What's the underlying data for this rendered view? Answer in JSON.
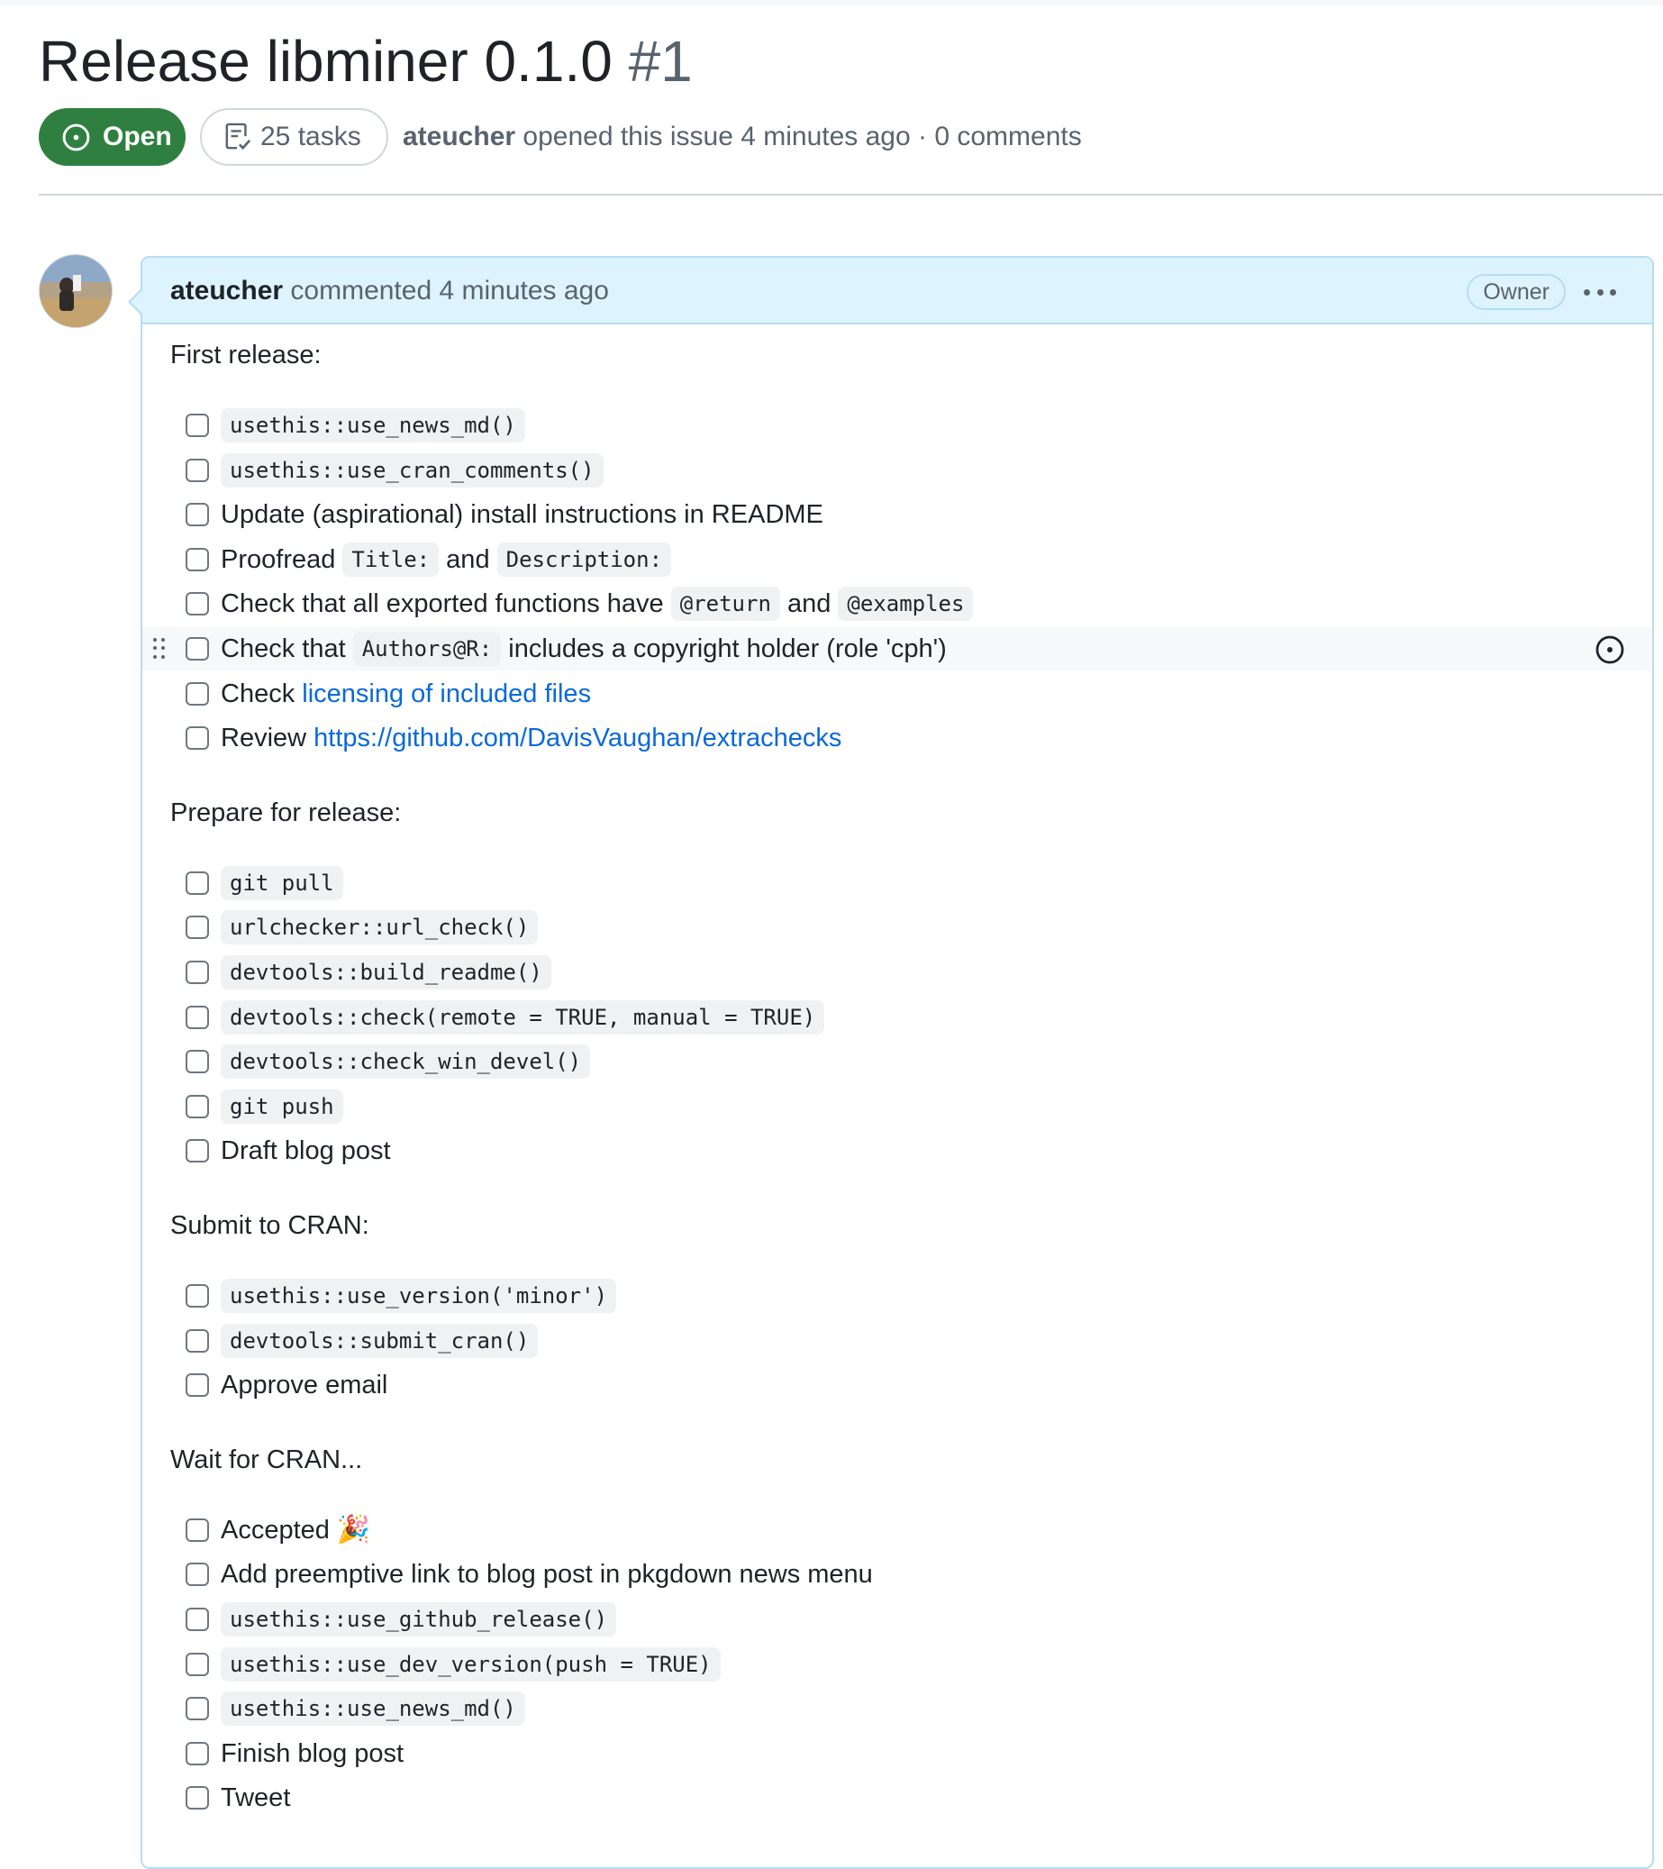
{
  "issue": {
    "title": "Release libminer 0.1.0",
    "number": "#1",
    "state": "Open",
    "tasks_label": "25 tasks",
    "author": "ateucher",
    "meta_text": " opened this issue 4 minutes ago · 0 comments"
  },
  "comment": {
    "author": "ateucher",
    "meta_text": " commented 4 minutes ago",
    "badge": "Owner"
  },
  "icons": {
    "state": "issue-opened-icon",
    "tasks": "checklist-icon",
    "kebab": "kebab-horizontal-icon",
    "drag": "grabber-icon",
    "convert": "issue-opened-icon"
  },
  "colors": {
    "open_green": "#2f8040",
    "link_blue": "#0969da",
    "header_bg": "#ddf4ff",
    "header_border": "#b6dcf5"
  },
  "sections": [
    {
      "heading": "First release:",
      "tasks": [
        [
          {
            "t": "code",
            "v": "usethis::use_news_md()"
          }
        ],
        [
          {
            "t": "code",
            "v": "usethis::use_cran_comments()"
          }
        ],
        [
          {
            "t": "text",
            "v": "Update (aspirational) install instructions in README"
          }
        ],
        [
          {
            "t": "text",
            "v": "Proofread "
          },
          {
            "t": "code",
            "v": "Title:"
          },
          {
            "t": "text",
            "v": " and "
          },
          {
            "t": "code",
            "v": "Description:"
          }
        ],
        [
          {
            "t": "text",
            "v": "Check that all exported functions have "
          },
          {
            "t": "code",
            "v": "@return"
          },
          {
            "t": "text",
            "v": " and "
          },
          {
            "t": "code",
            "v": "@examples"
          }
        ],
        [
          {
            "t": "text",
            "v": "Check that "
          },
          {
            "t": "code",
            "v": "Authors@R:"
          },
          {
            "t": "text",
            "v": " includes a copyright holder (role 'cph')"
          }
        ],
        [
          {
            "t": "text",
            "v": "Check "
          },
          {
            "t": "link",
            "v": "licensing of included files"
          }
        ],
        [
          {
            "t": "text",
            "v": "Review "
          },
          {
            "t": "link",
            "v": "https://github.com/DavisVaughan/extrachecks"
          }
        ]
      ]
    },
    {
      "heading": "Prepare for release:",
      "tasks": [
        [
          {
            "t": "code",
            "v": "git pull"
          }
        ],
        [
          {
            "t": "code",
            "v": "urlchecker::url_check()"
          }
        ],
        [
          {
            "t": "code",
            "v": "devtools::build_readme()"
          }
        ],
        [
          {
            "t": "code",
            "v": "devtools::check(remote = TRUE, manual = TRUE)"
          }
        ],
        [
          {
            "t": "code",
            "v": "devtools::check_win_devel()"
          }
        ],
        [
          {
            "t": "code",
            "v": "git push"
          }
        ],
        [
          {
            "t": "text",
            "v": "Draft blog post"
          }
        ]
      ]
    },
    {
      "heading": "Submit to CRAN:",
      "tasks": [
        [
          {
            "t": "code",
            "v": "usethis::use_version('minor')"
          }
        ],
        [
          {
            "t": "code",
            "v": "devtools::submit_cran()"
          }
        ],
        [
          {
            "t": "text",
            "v": "Approve email"
          }
        ]
      ]
    },
    {
      "heading": "Wait for CRAN...",
      "tasks": [
        [
          {
            "t": "text",
            "v": "Accepted"
          },
          {
            "t": "emoji",
            "v": "🎉"
          }
        ],
        [
          {
            "t": "text",
            "v": "Add preemptive link to blog post in pkgdown news menu"
          }
        ],
        [
          {
            "t": "code",
            "v": "usethis::use_github_release()"
          }
        ],
        [
          {
            "t": "code",
            "v": "usethis::use_dev_version(push = TRUE)"
          }
        ],
        [
          {
            "t": "code",
            "v": "usethis::use_news_md()"
          }
        ],
        [
          {
            "t": "text",
            "v": "Finish blog post"
          }
        ],
        [
          {
            "t": "text",
            "v": "Tweet"
          }
        ]
      ]
    }
  ]
}
